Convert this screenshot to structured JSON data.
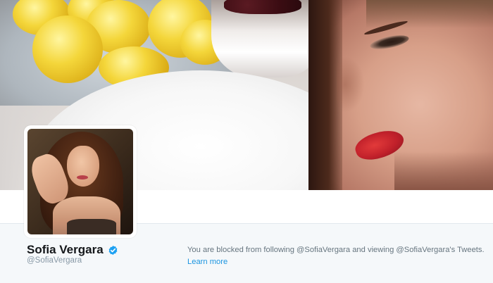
{
  "profile": {
    "name": "Sofia Vergara",
    "handle": "@SofiaVergara",
    "verified": true,
    "verified_icon": "verified-badge-icon"
  },
  "notice": {
    "blocked_text": "You are blocked from following @SofiaVergara and viewing @SofiaVergara's Tweets.",
    "learn_more": "Learn more"
  },
  "colors": {
    "accent": "#1b95e0",
    "verified": "#1da1f2",
    "page_bg": "#f5f8fa"
  }
}
